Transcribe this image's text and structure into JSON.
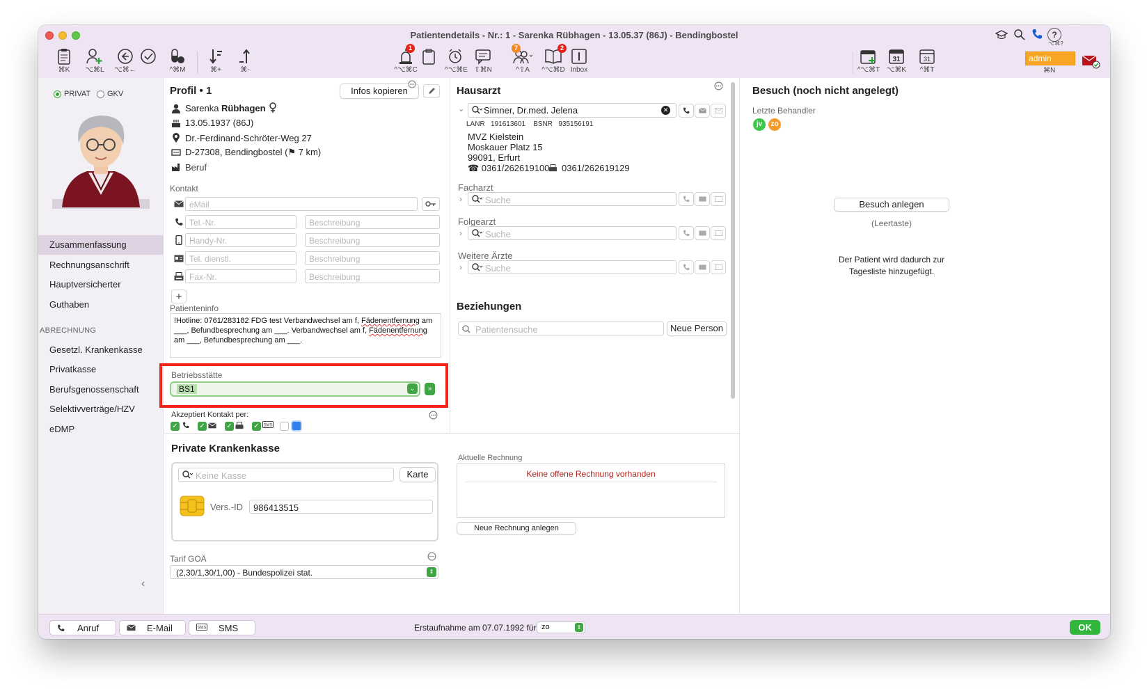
{
  "window": {
    "title": "Patientendetails - Nr.: 1 - Sarenka Rübhagen - 13.05.37 (86J) - Bendingbostel"
  },
  "toolbar": {
    "left": [
      {
        "icon": "clipboard-icon",
        "shortcut": "⌘K"
      },
      {
        "icon": "person-add-icon",
        "shortcut": "⌥⌘L"
      },
      {
        "icon": "back-arrow-icon",
        "shortcut": "⌥⌘←"
      },
      {
        "icon": "checkmark-circle-icon",
        "shortcut": ""
      },
      {
        "icon": "pills-icon",
        "shortcut": "^⌘M"
      },
      {
        "icon": "sort-down-icon",
        "shortcut": "⌘+"
      },
      {
        "icon": "sort-up-icon",
        "shortcut": "⌘-"
      }
    ],
    "center": [
      {
        "icon": "alarm-light-icon",
        "shortcut": "^⌥⌘C",
        "badge": "1"
      },
      {
        "icon": "clipboard-task-icon",
        "shortcut": ""
      },
      {
        "icon": "alarm-clock-icon",
        "shortcut": "^⌥⌘E"
      },
      {
        "icon": "message-icon",
        "shortcut": "⇧⌘N"
      },
      {
        "icon": "team-icon",
        "shortcut": "^⇧A",
        "badge": "7"
      },
      {
        "icon": "book-icon",
        "shortcut": "^⌥⌘D",
        "badge": "2"
      },
      {
        "icon": "inbox-icon",
        "shortcut": "Inbox"
      }
    ],
    "right": [
      {
        "icon": "calendar-add-icon",
        "shortcut": "^⌥⌘T"
      },
      {
        "icon": "calendar-31-icon",
        "shortcut": "⌥⌘K",
        "day": "31"
      },
      {
        "icon": "calendar-31-outline-icon",
        "shortcut": "^⌘T",
        "day": "31"
      }
    ],
    "user": {
      "name": "admin",
      "shortcut": "⌘N"
    },
    "help_shortcut": "⌥⌘?"
  },
  "sidebar": {
    "radio_privat": "PRIVAT",
    "radio_gkv": "GKV",
    "items": [
      {
        "label": "Zusammenfassung",
        "active": true
      },
      {
        "label": "Rechnungsanschrift"
      },
      {
        "label": "Hauptversicherter"
      },
      {
        "label": "Guthaben"
      }
    ],
    "section_header": "ABRECHNUNG",
    "billing_items": [
      {
        "label": "Gesetzl. Krankenkasse"
      },
      {
        "label": "Privatkasse"
      },
      {
        "label": "Berufsgenossenschaft"
      },
      {
        "label": "Selektivverträge/HZV"
      },
      {
        "label": "eDMP"
      }
    ],
    "collapse_glyph": "‹"
  },
  "profile": {
    "title": "Profil",
    "number": "1",
    "infos_button": "Infos kopieren",
    "first_name": "Sarenka",
    "last_name": "Rübhagen",
    "birth": "13.05.1937 (86J)",
    "street": "Dr.-Ferdinand-Schröter-Weg 27",
    "city": "D-27308, Bendingbostel (⚑ 7 km)",
    "occupation_placeholder": "Beruf"
  },
  "contact": {
    "label": "Kontakt",
    "email_placeholder": "eMail",
    "rows": [
      {
        "placeholder": "Tel.-Nr.",
        "desc": "Beschreibung"
      },
      {
        "placeholder": "Handy-Nr.",
        "desc": "Beschreibung"
      },
      {
        "placeholder": "Tel. dienstl.",
        "desc": "Beschreibung"
      },
      {
        "placeholder": "Fax-Nr.",
        "desc": "Beschreibung"
      }
    ],
    "add_glyph": "+"
  },
  "patient_info": {
    "label": "Patienteninfo",
    "text_a": "!Hotline: 0761/283182 FDG test Verbandwechsel am f, ",
    "text_b": "Fädenentfernung",
    "text_c": " am ___, Befundbesprechung am ___. Verbandwechsel am f, ",
    "text_d": "Fädenentfernung",
    "text_e": " am ___, Befundbesprechung am ___."
  },
  "betriebsstaette": {
    "label": "Betriebsstätte",
    "value": "BS1",
    "highlight_color": "#f02419"
  },
  "accepts_contact": {
    "label": "Akzeptiert Kontakt per:"
  },
  "hausarzt": {
    "title": "Hausarzt",
    "name": "Simner, Dr.med. Jelena",
    "lanr_label": "LANR",
    "lanr": "191613601",
    "bsnr_label": "BSNR",
    "bsnr": "935156191",
    "org": "MVZ Kielstein",
    "street": "Moskauer Platz 15",
    "city": "99091, Erfurt",
    "phone": "☎ 0361/262619100",
    "fax": "0361/262619129"
  },
  "facharzt": {
    "label": "Facharzt",
    "placeholder": "Suche"
  },
  "folgearzt": {
    "label": "Folgearzt",
    "placeholder": "Suche"
  },
  "weitere": {
    "label": "Weitere Ärzte",
    "placeholder": "Suche"
  },
  "beziehungen": {
    "title": "Beziehungen",
    "search_placeholder": "Patientensuche",
    "new_person": "Neue Person"
  },
  "besuch": {
    "title": "Besuch (noch nicht angelegt)",
    "last_label": "Letzte Behandler",
    "pills": [
      {
        "text": "jv",
        "color": "#3cc94b"
      },
      {
        "text": "zo",
        "color": "#f39a2c"
      }
    ],
    "button": "Besuch anlegen",
    "hint": "(Leertaste)",
    "info_line1": "Der Patient wird dadurch zur",
    "info_line2": "Tagesliste hinzugefügt."
  },
  "private_kasse": {
    "title": "Private Krankenkasse",
    "search_placeholder": "Keine Kasse",
    "card_button": "Karte",
    "vers_label": "Vers.-ID",
    "vers_value": "986413515",
    "tarif_label": "Tarif GOÄ",
    "tarif_value": "(2,30/1,30/1,00) - Bundespolizei stat."
  },
  "rechnung": {
    "label": "Aktuelle Rechnung",
    "none_text": "Keine offene Rechnung vorhanden",
    "none_color": "#b3201a",
    "new_button": "Neue Rechnung anlegen"
  },
  "bottom": {
    "call": "Anruf",
    "email": "E-Mail",
    "sms": "SMS",
    "erstaufnahme": "Erstaufnahme am 07.07.1992 für",
    "doctor": "zo",
    "ok": "OK"
  }
}
